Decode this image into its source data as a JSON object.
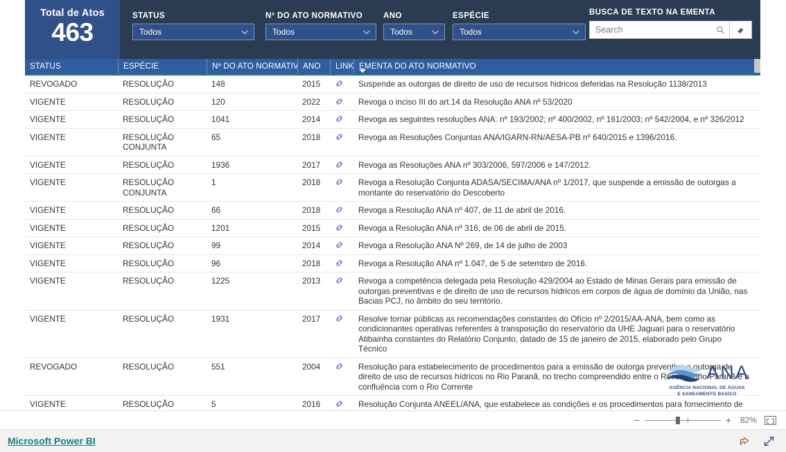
{
  "kpi": {
    "title": "Total de Atos",
    "value": "463"
  },
  "slicers": [
    {
      "label": "STATUS",
      "value": "Todos",
      "icon": "chevron-down-icon"
    },
    {
      "label": "Nº DO ATO NORMATIVO",
      "value": "Todos",
      "icon": "chevron-down-icon"
    },
    {
      "label": "ANO",
      "value": "Todos",
      "icon": "chevron-down-icon"
    },
    {
      "label": "ESPÉCIE",
      "value": "Todos",
      "icon": "chevron-down-icon"
    }
  ],
  "search": {
    "label": "BUSCA DE TEXTO NA EMENTA",
    "placeholder": "Search",
    "value": "",
    "search_icon": "search-icon",
    "clear_icon": "eraser-icon"
  },
  "table": {
    "columns": [
      "STATUS",
      "ESPÉCIE",
      "Nº DO ATO NORMATIVO",
      "ANO",
      "LINK",
      "EMENTA DO ATO NORMATIVO"
    ],
    "sorted_column": "EMENTA DO ATO NORMATIVO",
    "sort_direction": "descending",
    "link_icon": "chain-link-icon",
    "rows": [
      {
        "status": "REVOGADO",
        "especie": "RESOLUÇÃO",
        "numero": "148",
        "ano": "2015",
        "ementa": "Suspende as outorgas de direito de uso de recursos hidricos deferidas na Resolução 1138/2013"
      },
      {
        "status": "VIGENTE",
        "especie": "RESOLUÇÃO",
        "numero": "120",
        "ano": "2022",
        "ementa": "Revoga o inciso III do art.14 da Resolução ANA nº 53/2020"
      },
      {
        "status": "VIGENTE",
        "especie": "RESOLUÇÃO",
        "numero": "1041",
        "ano": "2014",
        "ementa": "Revoga as seguintes resoluções ANA: nº 193/2002; nº 400/2002, nº 161/2003; nº 542/2004, e nº 326/2012"
      },
      {
        "status": "VIGENTE",
        "especie": "RESOLUÇÃO CONJUNTA",
        "numero": "65",
        "ano": "2018",
        "ementa": "Revoga as Resoluções Conjuntas ANA/IGARN-RN/AESA-PB nº 640/2015 e 1396/2016."
      },
      {
        "status": "VIGENTE",
        "especie": "RESOLUÇÃO",
        "numero": "1936",
        "ano": "2017",
        "ementa": "Revoga as Resoluções ANA nº 303/2006, 597/2006 e 147/2012."
      },
      {
        "status": "VIGENTE",
        "especie": "RESOLUÇÃO CONJUNTA",
        "numero": "1",
        "ano": "2018",
        "ementa": "Revoga a Resolução Conjunta ADASA/SECIMA/ANA nº 1/2017, que suspende a emissão de outorgas a montante do reservatório do Descoberto"
      },
      {
        "status": "VIGENTE",
        "especie": "RESOLUÇÃO",
        "numero": "66",
        "ano": "2018",
        "ementa": "Revoga a Resolução ANA nº 407, de 11 de abril de 2016."
      },
      {
        "status": "VIGENTE",
        "especie": "RESOLUÇÃO",
        "numero": "1201",
        "ano": "2015",
        "ementa": "Revoga a Resolução ANA nº 316, de 06 de abril de 2015."
      },
      {
        "status": "VIGENTE",
        "especie": "RESOLUÇÃO",
        "numero": "99",
        "ano": "2014",
        "ementa": "Revoga a Resolução ANA Nº 269, de 14 de julho de 2003"
      },
      {
        "status": "VIGENTE",
        "especie": "RESOLUÇÃO",
        "numero": "96",
        "ano": "2018",
        "ementa": "Revoga a Resolução ANA nº 1.047, de 5 de setembro de 2016."
      },
      {
        "status": "VIGENTE",
        "especie": "RESOLUÇÃO",
        "numero": "1225",
        "ano": "2013",
        "ementa": "Revoga a competência delegada pela Resolução 429/2004 ao Estado de Minas Gerais para emissão de outorgas preventivas e de direito de uso de recursos hídricos em corpos de água de domínio da União, nas Bacias PCJ, no âmbito do seu território."
      },
      {
        "status": "VIGENTE",
        "especie": "RESOLUÇÃO",
        "numero": "1931",
        "ano": "2017",
        "ementa": "Resolve tornar públicas as recomendações constantes do Ofício nº 2/2015/AA-ANA, bem como as condicionantes operativas referentes à transposição do reservatório da UHE Jaguari para o reservatório Atibainha constantes do Relatório Conjunto, datado de 15 de janeiro de 2015, elaborado pelo Grupo Técnico"
      },
      {
        "status": "REVOGADO",
        "especie": "RESOLUÇÃO",
        "numero": "551",
        "ano": "2004",
        "ementa": "Resolução para estabelecimento de procedimentos para a emissão de outorga preventiva e outorga de direito de uso de recursos hídricos no Rio Paranã, no trecho compreendido entre o Reservatório Paranã e a confluência com o Rio Corrente"
      },
      {
        "status": "VIGENTE",
        "especie": "RESOLUÇÃO CONJUNTA",
        "numero": "5",
        "ano": "2016",
        "ementa": "Resolução Conjunta ANEEL/ANA, que estabelece as condições e os procedimentos para fornecimento de informações de unidades consumidoras associadas as atividades de irrigação e aquicultura para a Agência Nacional de Águas."
      }
    ]
  },
  "logo": {
    "acronym": "ANA",
    "line1": "AGÊNCIA NACIONAL DE ÁGUAS",
    "line2": "E SANEAMENTO BÁSICO"
  },
  "zoom_bar": {
    "minus": "−",
    "plus": "+",
    "percent": "82%",
    "fit_icon": "fit-to-page-icon"
  },
  "status_bar": {
    "brand": "Microsoft Power BI",
    "share_icon": "share-icon",
    "fullscreen_icon": "fullscreen-icon"
  },
  "colors": {
    "panel_navy": "#2b3c52",
    "kpi_blue": "#2f5088",
    "header_blue": "#2f5da0",
    "teal_accent": "#2f7d78",
    "link_teal": "#1d7b80",
    "logo_blue": "#2b4b87"
  }
}
